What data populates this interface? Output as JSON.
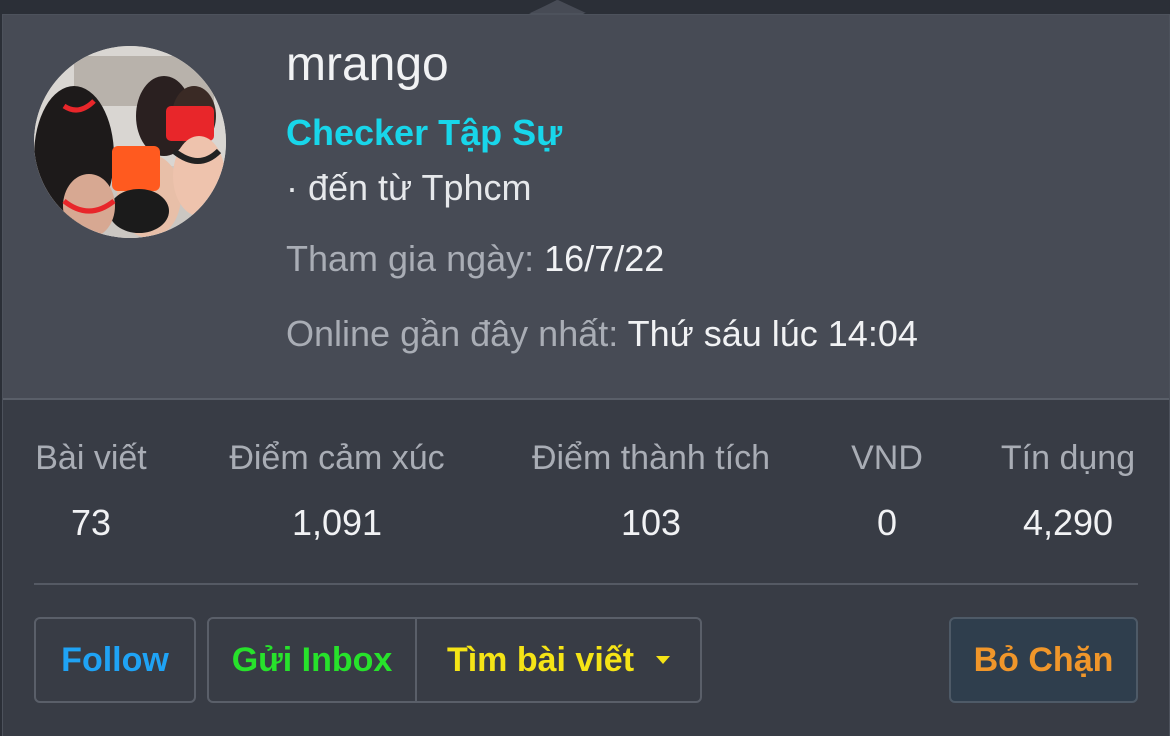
{
  "profile": {
    "username": "mrango",
    "rank": "Checker Tập Sự",
    "location": "· đến từ Tphcm",
    "joined_label": "Tham gia ngày:",
    "joined_value": "16/7/22",
    "online_label": "Online gần đây nhất:",
    "online_value": "Thứ sáu lúc 14:04"
  },
  "stats": [
    {
      "label": "Bài viết",
      "value": "73"
    },
    {
      "label": "Điểm cảm xúc",
      "value": "1,091"
    },
    {
      "label": "Điểm thành tích",
      "value": "103"
    },
    {
      "label": "VND",
      "value": "0"
    },
    {
      "label": "Tín dụng",
      "value": "4,290"
    }
  ],
  "actions": {
    "follow": "Follow",
    "inbox": "Gửi Inbox",
    "find_posts": "Tìm bài viết",
    "unblock": "Bỏ Chặn"
  },
  "colors": {
    "rank": "#18d6ea",
    "follow": "#1fa3f5",
    "inbox": "#27e22b",
    "find_posts": "#f5e416",
    "unblock": "#f0962a"
  }
}
